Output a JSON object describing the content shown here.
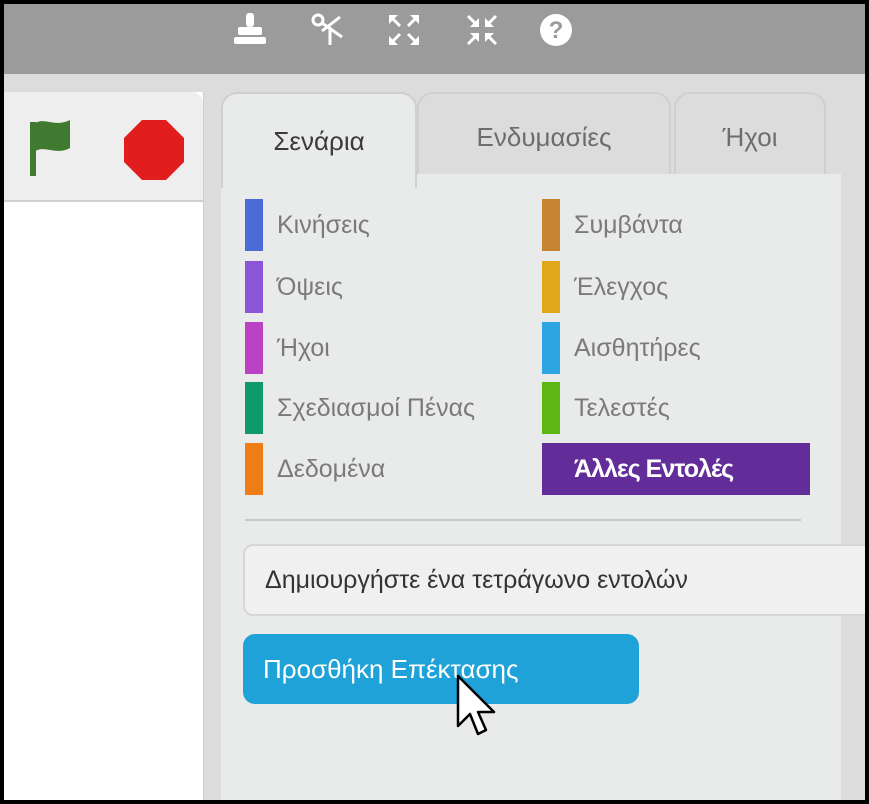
{
  "toolbar": {
    "tools": [
      {
        "icon": "stamp-icon"
      },
      {
        "icon": "scissors-icon"
      },
      {
        "icon": "grow-icon"
      },
      {
        "icon": "shrink-icon"
      },
      {
        "icon": "help-icon"
      }
    ]
  },
  "stage": {
    "green_flag_color": "#3f7a30",
    "stop_color": "#e21d1d"
  },
  "tabs": [
    {
      "label": "Σενάρια",
      "active": true
    },
    {
      "label": "Ενδυμασίες",
      "active": false
    },
    {
      "label": "Ήχοι",
      "active": false
    }
  ],
  "categories": {
    "left": [
      {
        "label": "Κινήσεις",
        "color": "#4a6cd4"
      },
      {
        "label": "Όψεις",
        "color": "#8a55d7"
      },
      {
        "label": "Ήχοι",
        "color": "#bb42c3"
      },
      {
        "label": "Σχεδιασμοί Πένας",
        "color": "#0e9a6c"
      },
      {
        "label": "Δεδομένα",
        "color": "#ee7d16"
      }
    ],
    "right": [
      {
        "label": "Συμβάντα",
        "color": "#c88330"
      },
      {
        "label": "Έλεγχος",
        "color": "#e1a91a"
      },
      {
        "label": "Αισθητήρες",
        "color": "#2ca5e2"
      },
      {
        "label": "Τελεστές",
        "color": "#5cb712"
      },
      {
        "label": "Άλλες Εντολές",
        "color": "#632d99",
        "selected": true
      }
    ]
  },
  "buttons": {
    "make_block": "Δημιουργήστε ένα τετράγωνο εντολών",
    "add_extension": "Προσθήκη Επέκτασης"
  },
  "colors": {
    "accent": "#1fa2d8",
    "toolbar": "#9b9b9b",
    "panel": "#e9eaea"
  }
}
